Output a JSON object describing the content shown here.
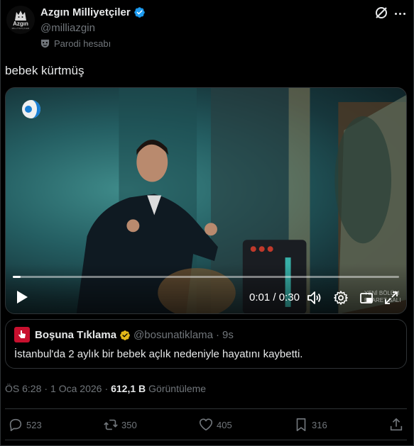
{
  "author": {
    "display_name": "Azgın Milliyetçiler",
    "handle": "@milliazgin",
    "parody_label": "Parodi hesabı",
    "avatar_text": "Azgın",
    "avatar_subtext": "MİLLİYETÇİLER",
    "verified": true
  },
  "tweet": {
    "text": "bebek kürtmüş"
  },
  "video": {
    "current_time": "0:01",
    "separator": "/",
    "duration": "0:30",
    "progress_fraction": 0.02,
    "watermark_line1": "YENİ BÖLÜM",
    "watermark_line2": "ESARET SALI"
  },
  "quote": {
    "display_name": "Boşuna Tıklama",
    "handle": "@bosunatiklama",
    "dot": "·",
    "time": "9s",
    "text": "İstanbul'da 2 aylık bir bebek açlık nedeniyle hayatını kaybetti."
  },
  "meta": {
    "time": "ÖS 6:28",
    "dot1": "·",
    "date": "1 Oca 2026",
    "dot2": "·",
    "views_count": "612,1 B",
    "views_label": "Görüntüleme"
  },
  "actions": {
    "replies": "523",
    "reposts": "350",
    "likes": "405",
    "bookmarks": "316"
  },
  "colors": {
    "background": "#000000",
    "text": "#e7e9ea",
    "muted": "#71767b",
    "border": "#2f3336",
    "verified_blue": "#1d9bf0",
    "verified_gold": "#e2b719",
    "quote_brand_red": "#c8102e"
  },
  "icons": {
    "grok": "grok-icon",
    "more": "more-icon",
    "mask": "theater-mask-icon",
    "play": "play-icon",
    "volume": "volume-icon",
    "settings": "gear-icon",
    "pip": "pip-icon",
    "fullscreen": "fullscreen-icon",
    "reply": "reply-icon",
    "repost": "repost-icon",
    "like": "heart-icon",
    "bookmark": "bookmark-icon",
    "share": "share-icon"
  }
}
